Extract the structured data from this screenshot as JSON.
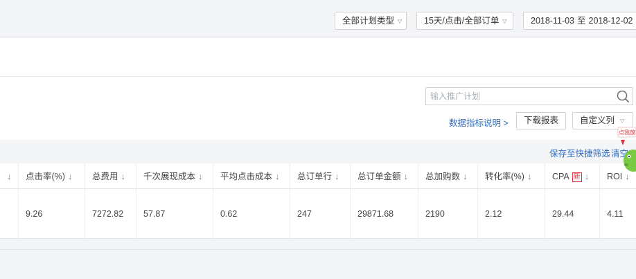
{
  "header": {
    "plan_type": "全部计划类型",
    "attribution": "15天/点击/全部订单",
    "date_from": "2018-11-03",
    "date_sep": "至",
    "date_to": "2018-12-02"
  },
  "toolbar": {
    "search_placeholder": "输入推广计划",
    "metrics_link": "数据指标说明 >",
    "download_label": "下载报表",
    "custom_columns_label": "自定义列"
  },
  "filters": {
    "save_label": "保存至快捷筛选",
    "clear_label": "清空"
  },
  "table": {
    "columns": [
      {
        "label": "点击率(%)",
        "sort": "↓"
      },
      {
        "label": "总费用",
        "sort": "↓"
      },
      {
        "label": "千次展现成本",
        "sort": "↓"
      },
      {
        "label": "平均点击成本",
        "sort": "↓"
      },
      {
        "label": "总订单行",
        "sort": "↓"
      },
      {
        "label": "总订单金额",
        "sort": "↓"
      },
      {
        "label": "总加购数",
        "sort": "↓"
      },
      {
        "label": "转化率(%)",
        "sort": "↓"
      },
      {
        "label": "CPA",
        "badge": "新",
        "sort": "↓"
      },
      {
        "label": "ROI",
        "sort": "↓"
      }
    ],
    "first_col_sort": "↓",
    "row": [
      "9.26",
      "7272.82",
      "57.87",
      "0.62",
      "247",
      "29871.68",
      "2190",
      "2.12",
      "29.44",
      "4.11"
    ]
  },
  "mascot": {
    "label": "点我放"
  },
  "colors": {
    "link": "#2e6cc0",
    "badge": "#e0353a",
    "mascot": "#7ac943"
  }
}
